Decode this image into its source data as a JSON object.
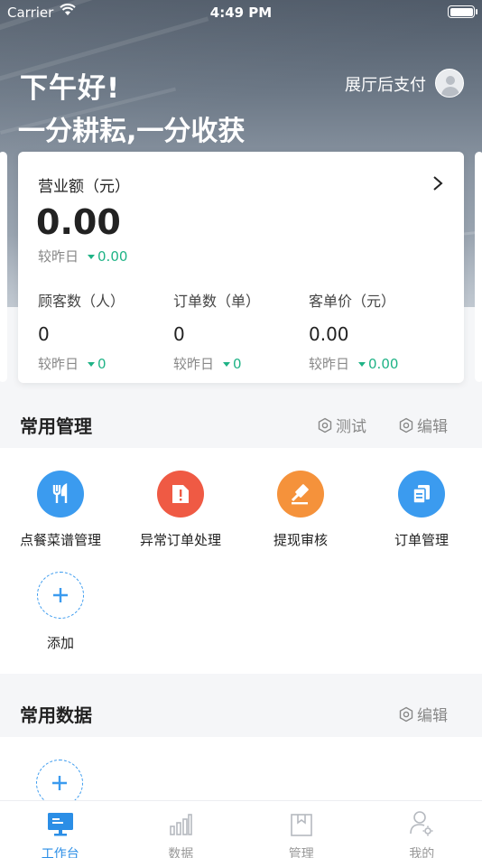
{
  "status_bar": {
    "carrier": "Carrier",
    "time": "4:49 PM"
  },
  "header": {
    "greeting": "下午好!",
    "slogan": "一分耕耘,一分收获",
    "pay_mode": "展厅后支付"
  },
  "revenue_card": {
    "label": "营业额（元）",
    "value": "0.00",
    "compare_label": "较昨日",
    "compare_delta": "0.00",
    "stats": [
      {
        "label": "顾客数（人）",
        "value": "0",
        "compare_label": "较昨日",
        "compare_delta": "0"
      },
      {
        "label": "订单数（单）",
        "value": "0",
        "compare_label": "较昨日",
        "compare_delta": "0"
      },
      {
        "label": "客单价（元）",
        "value": "0.00",
        "compare_label": "较昨日",
        "compare_delta": "0.00"
      }
    ]
  },
  "common_management": {
    "title": "常用管理",
    "test_label": "测试",
    "edit_label": "编辑",
    "tools": [
      {
        "label": "点餐菜谱管理",
        "icon": "fork-knife-icon",
        "color": "#3b9bef"
      },
      {
        "label": "异常订单处理",
        "icon": "alert-document-icon",
        "color": "#ef5a44"
      },
      {
        "label": "提现审核",
        "icon": "gavel-icon",
        "color": "#f5923b"
      },
      {
        "label": "订单管理",
        "icon": "documents-icon",
        "color": "#3b9bef"
      }
    ],
    "add_label": "添加"
  },
  "common_data": {
    "title": "常用数据",
    "edit_label": "编辑"
  },
  "tabbar": {
    "tabs": [
      {
        "label": "工作台",
        "icon": "monitor-icon"
      },
      {
        "label": "数据",
        "icon": "bar-chart-icon"
      },
      {
        "label": "管理",
        "icon": "clipboard-icon"
      },
      {
        "label": "我的",
        "icon": "user-settings-icon"
      }
    ],
    "active_tab": "工作台",
    "accent_color": "#2b8ee6"
  }
}
